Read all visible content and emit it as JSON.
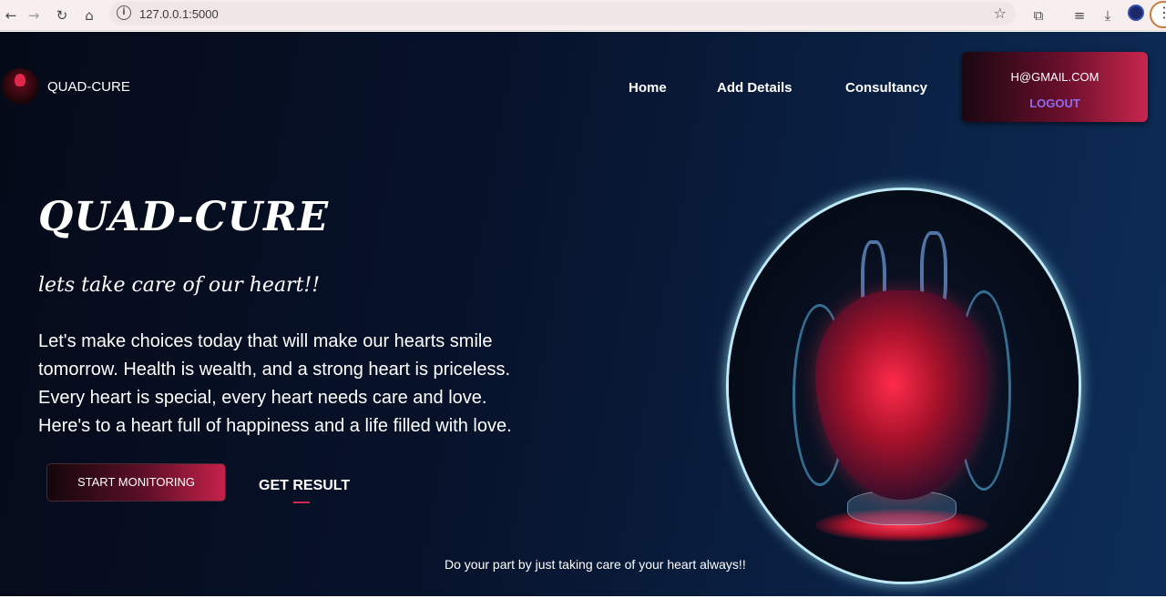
{
  "browser": {
    "url": "127.0.0.1:5000",
    "icons": [
      "back-icon",
      "forward-icon",
      "reload-icon",
      "home-icon",
      "info-icon",
      "star-icon",
      "extensions-icon",
      "media-icon",
      "download-icon",
      "profile-icon",
      "menu-icon"
    ]
  },
  "header": {
    "brand": "QUAD-CURE",
    "nav": [
      "Home",
      "Add Details",
      "Consultancy"
    ],
    "account": {
      "email": "H@GMAIL.COM",
      "logout": "LOGOUT"
    }
  },
  "hero": {
    "title": "QUAD-CURE",
    "subtitle": "lets take care of our heart!!",
    "text_lines": [
      "Let's make choices today that will make our hearts smile",
      "tomorrow. Health is wealth, and a strong heart is priceless.",
      "Every heart is special, every heart needs care and love.",
      "Here's to a heart full of happiness and a life filled with love."
    ],
    "primary_button": "START MONITORING",
    "secondary_button": "GET RESULT"
  },
  "footer_note": "Do your part by just taking care of your heart always!!",
  "colors": {
    "background": "#07122a",
    "accent": "#c8264c",
    "logout": "#8e6cf0"
  }
}
